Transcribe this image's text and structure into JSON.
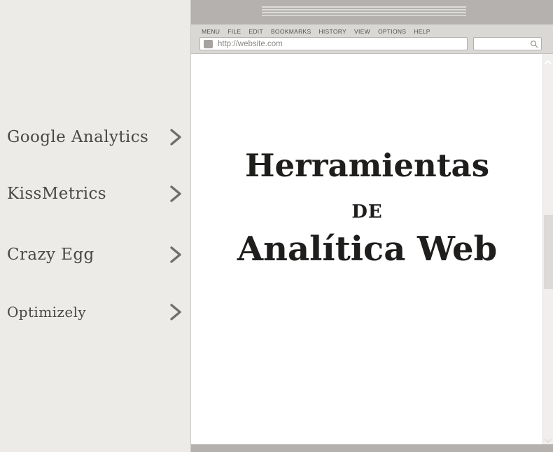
{
  "sidebar": {
    "items": [
      {
        "label": "Google Analytics"
      },
      {
        "label": "KissMetrics"
      },
      {
        "label": "Crazy Egg"
      },
      {
        "label": "Optimizely"
      }
    ]
  },
  "browser": {
    "menu": [
      "MENU",
      "FILE",
      "EDIT",
      "BOOKMARKS",
      "HISTORY",
      "VIEW",
      "OPTIONS",
      "HELP"
    ],
    "address": "http://website.com",
    "search_value": ""
  },
  "poster": {
    "line1": "Herramientas",
    "line2": "DE",
    "line3": "Analítica Web"
  },
  "colors": {
    "left_background": "#edebe8",
    "titlebar": "#b4b1ae",
    "chrome": "#dad8d5",
    "content": "#ffffff",
    "title_text": "#1f1e1c",
    "sidebar_text": "#4a4845",
    "menu_text": "#55534f",
    "url_text": "#8b8885",
    "chevron": "#706e6b"
  }
}
